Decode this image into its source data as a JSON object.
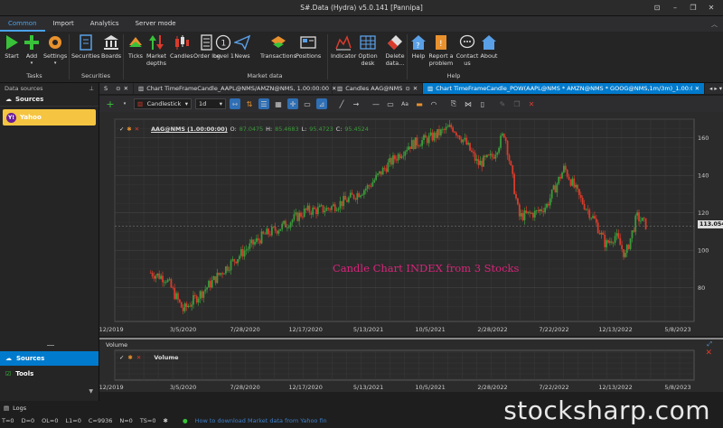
{
  "window": {
    "title": "S#.Data (Hydra) v5.0.141 [Pannipa]"
  },
  "menu_tabs": [
    {
      "label": "Common",
      "active": true
    },
    {
      "label": "Import",
      "active": false
    },
    {
      "label": "Analytics",
      "active": false
    },
    {
      "label": "Server mode",
      "active": false
    }
  ],
  "ribbon": {
    "start": "Start",
    "add": "Add",
    "settings": "Settings",
    "securities": "Securities",
    "boards": "Boards",
    "ticks": "Ticks",
    "market_depths": "Market depths",
    "candles": "Candles",
    "order_log": "Order log",
    "level1": "Level 1",
    "news": "News",
    "transactions": "Transactions",
    "positions": "Positions",
    "indicator": "Indicator",
    "option_desk": "Option desk",
    "delete_data": "Delete data...",
    "help": "Help",
    "report": "Report a problem",
    "contact": "Contact us",
    "about": "About",
    "groups": {
      "tasks": "Tasks",
      "securities": "Securities",
      "market_data": "Market data",
      "help": "Help"
    }
  },
  "left_panel": {
    "header": "Data sources",
    "section": "Sources",
    "yahoo": "Yahoo",
    "yahoo_badge": "Y!",
    "sources_btn": "Sources",
    "tools_btn": "Tools"
  },
  "doc_tabs": [
    {
      "label": "S",
      "active": false
    },
    {
      "label": "Chart TimeFrameCandle_AAPL@NMS/AMZN@NMS, 1.00:00:00",
      "active": false
    },
    {
      "label": "Candles AAG@NMS",
      "active": false
    },
    {
      "label": "Chart TimeFrameCandle_POW(AAPL@NMS * AMZN@NMS * GOOG@NMS,1m/3m)_1.00:00:00",
      "active": true
    }
  ],
  "chart_toolbar": {
    "style": "Candlestick",
    "timeframe": "1d"
  },
  "legend": {
    "symbol": "AAG@NMS (1.00:00:00)",
    "o_label": "O:",
    "o": "87.0475",
    "h_label": "H:",
    "h": "85.4683",
    "l_label": "L:",
    "l": "95.4723",
    "c_label": "C:",
    "c": "95.4524"
  },
  "annotation": "Candle Chart INDEX from 3 Stocks",
  "current_price": "113.054",
  "volume": {
    "pane_title": "Volume",
    "legend": "Volume"
  },
  "logs": "Logs",
  "status": {
    "t": "T=0",
    "d": "D=0",
    "ol": "OL=0",
    "l1": "L1=0",
    "c": "C=9936",
    "n": "N=0",
    "ts": "TS=0",
    "link": "How to download Market data from Yahoo fin"
  },
  "watermark": "stocksharp.com",
  "colors": {
    "up": "#3a9b3a",
    "down": "#d93b2b",
    "accent": "#007acc",
    "annotation": "#d8247a"
  },
  "chart_data": {
    "type": "candlestick",
    "x_ticks": [
      "9/12/2019",
      "3/5/2020",
      "7/28/2020",
      "12/17/2020",
      "5/13/2021",
      "10/5/2021",
      "2/28/2022",
      "7/22/2022",
      "12/13/2022",
      "5/8/2023"
    ],
    "y_ticks": [
      80,
      100,
      120,
      140,
      160
    ],
    "ylim": [
      62,
      170
    ],
    "trend": [
      {
        "x": "2019-12-20",
        "y": 88
      },
      {
        "x": "2020-01-25",
        "y": 85
      },
      {
        "x": "2020-03-05",
        "y": 68
      },
      {
        "x": "2020-04-20",
        "y": 78
      },
      {
        "x": "2020-06-10",
        "y": 90
      },
      {
        "x": "2020-07-28",
        "y": 100
      },
      {
        "x": "2020-09-10",
        "y": 108
      },
      {
        "x": "2020-10-25",
        "y": 113
      },
      {
        "x": "2020-12-17",
        "y": 121
      },
      {
        "x": "2021-02-05",
        "y": 122
      },
      {
        "x": "2021-03-25",
        "y": 127
      },
      {
        "x": "2021-05-13",
        "y": 134
      },
      {
        "x": "2021-06-25",
        "y": 145
      },
      {
        "x": "2021-08-15",
        "y": 156
      },
      {
        "x": "2021-10-05",
        "y": 160
      },
      {
        "x": "2021-11-25",
        "y": 166
      },
      {
        "x": "2021-12-25",
        "y": 158
      },
      {
        "x": "2022-01-25",
        "y": 146
      },
      {
        "x": "2022-02-28",
        "y": 150
      },
      {
        "x": "2022-03-28",
        "y": 163
      },
      {
        "x": "2022-05-01",
        "y": 118
      },
      {
        "x": "2022-06-10",
        "y": 120
      },
      {
        "x": "2022-07-05",
        "y": 124
      },
      {
        "x": "2022-08-15",
        "y": 144
      },
      {
        "x": "2022-09-20",
        "y": 128
      },
      {
        "x": "2022-10-25",
        "y": 116
      },
      {
        "x": "2022-11-20",
        "y": 103
      },
      {
        "x": "2022-12-13",
        "y": 108
      },
      {
        "x": "2023-01-05",
        "y": 97
      },
      {
        "x": "2023-02-01",
        "y": 118
      },
      {
        "x": "2023-02-25",
        "y": 113
      }
    ]
  }
}
